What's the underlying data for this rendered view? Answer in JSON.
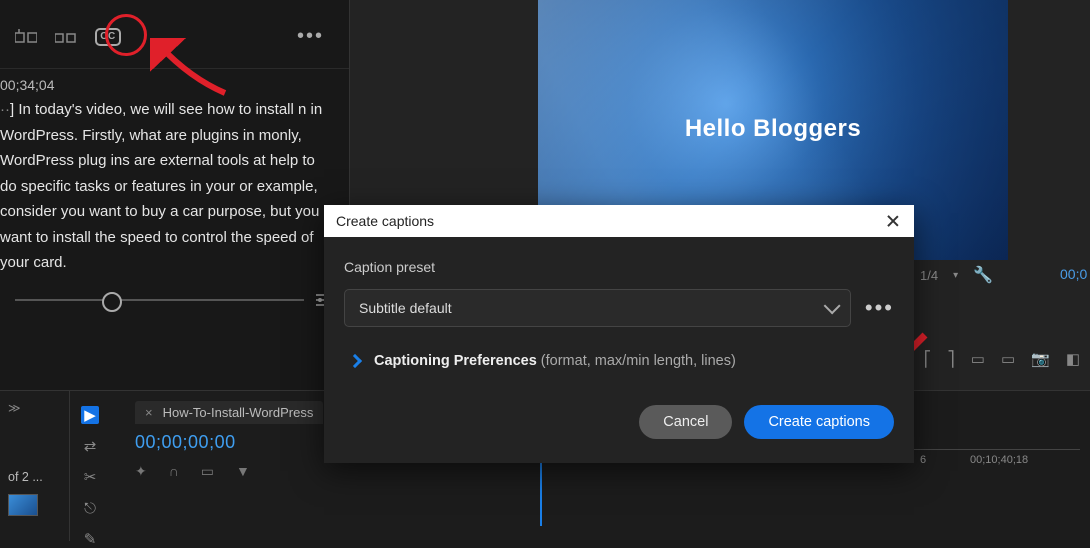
{
  "toolbar": {
    "cc_label": "CC"
  },
  "transcript": {
    "timecode": "00;34;04",
    "body": "] In today's video, we will see how to install n in WordPress. Firstly, what are plugins in monly, WordPress plug ins are external tools at help to do specific tasks or features in your or example, consider you want to buy a car  purpose, but you want to install the speed  to control the speed of your card."
  },
  "preview": {
    "title": "Hello Bloggers",
    "zoom": "1/4"
  },
  "monitor": {
    "timecode": "00;0"
  },
  "dialog": {
    "title": "Create captions",
    "preset_label": "Caption preset",
    "preset_value": "Subtitle default",
    "prefs_title": "Captioning Preferences",
    "prefs_hint": "(format, max/min length, lines)",
    "cancel": "Cancel",
    "create": "Create captions"
  },
  "project": {
    "count_text": "of 2 ..."
  },
  "sequence": {
    "tab_name": "How-To-Install-WordPress",
    "timecode": "00;00;00;00",
    "ruler_marks": [
      "6",
      "00;10;40;18"
    ]
  }
}
